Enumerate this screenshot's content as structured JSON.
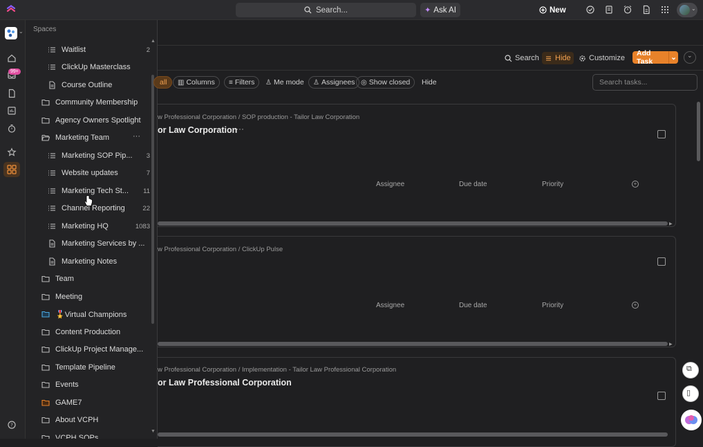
{
  "topbar": {
    "search_label": "Search...",
    "ask_ai_label": "Ask AI",
    "new_label": "New"
  },
  "rail": {
    "inbox_badge": "99+"
  },
  "sidebar": {
    "title": "Spaces",
    "items": [
      {
        "label": "Waitlist",
        "count": "2",
        "kind": "list"
      },
      {
        "label": "ClickUp Masterclass",
        "count": "",
        "kind": "list"
      },
      {
        "label": "Course Outline",
        "count": "",
        "kind": "doc"
      },
      {
        "label": "Community Membership",
        "count": "",
        "kind": "folder"
      },
      {
        "label": "Agency Owners Spotlight",
        "count": "",
        "kind": "folder"
      },
      {
        "label": "Marketing Team",
        "count": "",
        "kind": "folder-open"
      },
      {
        "label": "Marketing SOP Pip...",
        "count": "3",
        "kind": "list"
      },
      {
        "label": "Website updates",
        "count": "7",
        "kind": "list"
      },
      {
        "label": "Marketing Tech St...",
        "count": "11",
        "kind": "list"
      },
      {
        "label": "Channel Reporting",
        "count": "22",
        "kind": "list"
      },
      {
        "label": "Marketing HQ",
        "count": "1083",
        "kind": "list"
      },
      {
        "label": "Marketing Services by ...",
        "count": "",
        "kind": "doc"
      },
      {
        "label": "Marketing Notes",
        "count": "",
        "kind": "doc"
      },
      {
        "label": "Team",
        "count": "",
        "kind": "folder"
      },
      {
        "label": "Meeting",
        "count": "",
        "kind": "folder"
      },
      {
        "label": "🎖️Virtual Champions",
        "count": "",
        "kind": "folder-blue"
      },
      {
        "label": "Content Production",
        "count": "",
        "kind": "folder"
      },
      {
        "label": "ClickUp Project Manage...",
        "count": "",
        "kind": "folder"
      },
      {
        "label": "Template Pipeline",
        "count": "",
        "kind": "folder"
      },
      {
        "label": "Events",
        "count": "",
        "kind": "folder"
      },
      {
        "label": "GAME7",
        "count": "",
        "kind": "folder-orange"
      },
      {
        "label": "About VCPH",
        "count": "",
        "kind": "folder"
      },
      {
        "label": "VCPH SOPs",
        "count": "",
        "kind": "folder"
      }
    ]
  },
  "toolbar": {
    "search_label": "Search",
    "hide_label": "Hide",
    "customize_label": "Customize",
    "add_task_label": "Add Task"
  },
  "filters": {
    "all_label": "all",
    "columns_label": "Columns",
    "filters_label": "Filters",
    "me_mode_label": "Me mode",
    "assignees_label": "Assignees",
    "show_closed_label": "Show closed",
    "hide_label": "Hide",
    "search_placeholder": "Search tasks..."
  },
  "cards": [
    {
      "crumb": "w Professional Corporation / SOP production - Tailor Law Corporation",
      "title": "or Law Corporation",
      "col_assignee": "Assignee",
      "col_due": "Due date",
      "col_priority": "Priority"
    },
    {
      "crumb": "w Professional Corporation / ClickUp Pulse",
      "title": "",
      "col_assignee": "Assignee",
      "col_due": "Due date",
      "col_priority": "Priority"
    },
    {
      "crumb": "w Professional Corporation / Implementation - Tailor Law Professional Corporation",
      "title": "or Law Professional Corporation",
      "col_assignee": "",
      "col_due": "",
      "col_priority": ""
    }
  ],
  "colors": {
    "accent": "#e8822a",
    "badge": "#e04ea0"
  }
}
